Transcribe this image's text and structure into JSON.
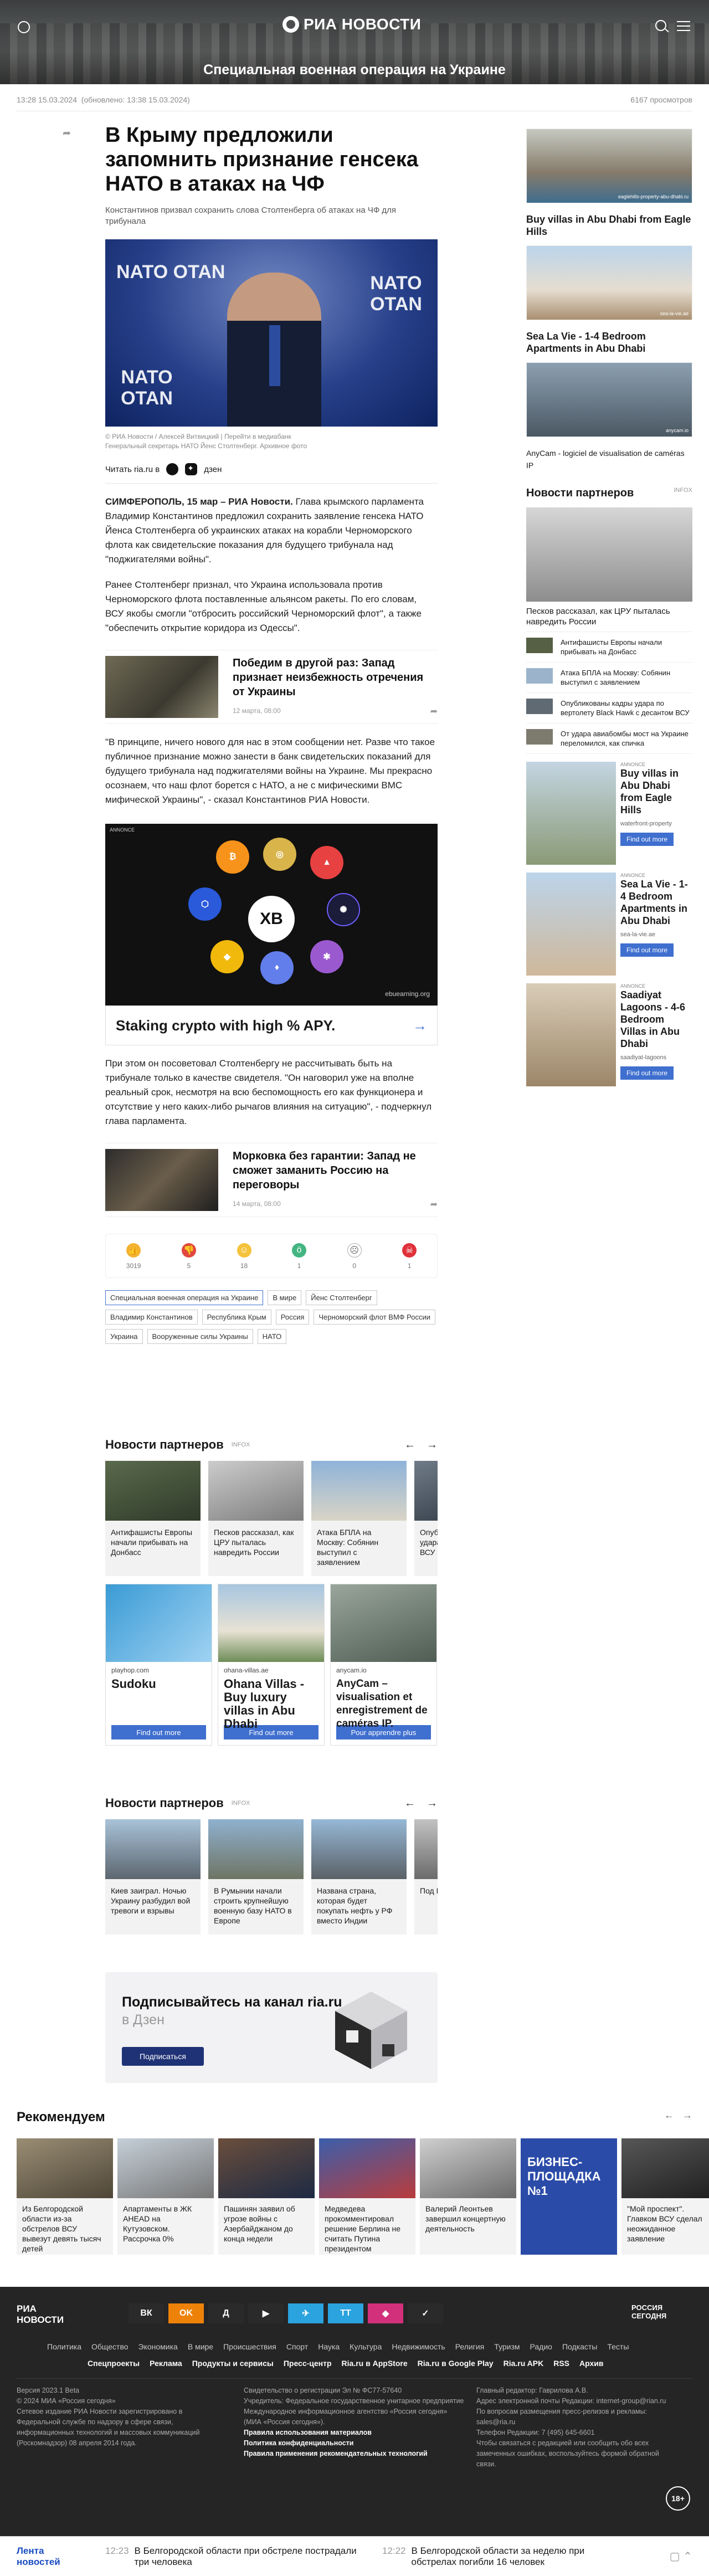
{
  "header": {
    "logo": "РИА НОВОСТИ",
    "section": "Специальная военная операция на Украине"
  },
  "meta": {
    "published": "13:28 15.03.2024",
    "updated": "(обновлено: 13:38 15.03.2024)",
    "views": "6167 просмотров"
  },
  "article": {
    "title": "В Крыму предложили запомнить признание генсека НАТО в атаках на ЧФ",
    "subtitle": "Константинов призвал сохранить слова Столтенберга об атаках на ЧФ для трибунала",
    "photo_labels": [
      "NATO OTAN",
      "NATO OTAN",
      "NATO OTAN"
    ],
    "caption1": "© РИА Новости / Алексей Витвицкий | Перейти в медиабанк",
    "caption2": "Генеральный секретарь НАТО Йенс Столтенберг. Архивное фото",
    "read_label": "Читать ria.ru в",
    "dzen": "дзен",
    "p1_lead": "СИМФЕРОПОЛЬ, 15 мар – РИА Новости.",
    "p1": " Глава крымского парламента Владимир Константинов предложил сохранить заявление генсека НАТО Йенса Столтенберга об украинских атаках на корабли Черноморского флота как свидетельские показания для будущего трибунала над \"поджигателями войны\".",
    "p2": "Ранее Столтенберг признал, что Украина использовала против Черноморского флота поставленные альянсом ракеты. По его словам, ВСУ якобы смогли \"отбросить российский Черноморский флот\", а также \"обеспечить открытие коридора из Одессы\".",
    "card1": {
      "title": "Победим в другой раз: Запад признает неизбежность отречения от Украины",
      "date": "12 марта, 08:00"
    },
    "p3": "\"В принципе, ничего нового для нас в этом сообщении нет. Разве что такое публичное признание можно занести в банк свидетельских показаний для будущего трибунала над поджигателями войны на Украине. Мы прекрасно осознаем, что наш флот борется с НАТО, а не с мифическими ВМС мифической Украины\", - сказал Константинов РИА Новости.",
    "ad": {
      "label": "ANNONCE",
      "title": "Staking crypto with high % APY.",
      "domain": "ebuearning.org",
      "mark": "XB"
    },
    "p4": "При этом он посоветовал Столтенбергу не рассчитывать быть на трибунале только в качестве свидетеля. \"Он наговорил уже на вполне реальный срок, несмотря на всю беспомощность его как функционера и отсутствие у него каких-либо рычагов влияния на ситуацию\", - подчеркнул глава парламента.",
    "card2": {
      "title": "Морковка без гарантии: Запад не сможет заманить Россию на переговоры",
      "date": "14 марта, 08:00"
    },
    "reactions": [
      "3019",
      "5",
      "18",
      "1",
      "0",
      "1"
    ],
    "tags": [
      "Специальная военная операция на Украине",
      "В мире",
      "Йенс Столтенберг",
      "Владимир Константинов",
      "Республика Крым",
      "Россия",
      "Черноморский флот ВМФ России",
      "Украина",
      "Вооруженные силы Украины",
      "НАТО"
    ]
  },
  "partners1": {
    "title": "Новости партнеров",
    "infox": "INFOX",
    "cards": [
      "Антифашисты Европы начали прибывать на Донбасс",
      "Песков рассказал, как ЦРУ пыталась навредить России",
      "Атака БПЛА на Москву: Собянин выступил с заявлением",
      "Опубликованы кадры удара по вертолету ВСУ"
    ]
  },
  "ads_row": [
    {
      "name": "playhop.com",
      "title": "Sudoku",
      "btn": "Find out more"
    },
    {
      "name": "ohana-villas.ae",
      "title": "Ohana Villas - Buy luxury villas in Abu Dhabi",
      "btn": "Find out more"
    },
    {
      "name": "anycam.io",
      "title": "AnyCam – visualisation et enregistrement de caméras IP.",
      "btn": "Pour apprendre plus"
    }
  ],
  "partners2": {
    "title": "Новости партнеров",
    "infox": "INFOX",
    "cards": [
      "Киев заиграл. Ночью Украину разбудил вой тревоги и взрывы",
      "В Румынии начали строить крупнейшую военную базу НАТО в Европе",
      "Названа страна, которая будет покупать нефть у РФ вместо Индии",
      "Под Кр…"
    ]
  },
  "dzen_banner": {
    "line1": "Подписывайтесь на канал ria.ru",
    "line2": "в Дзен",
    "btn": "Подписаться"
  },
  "sidebar": {
    "ads": [
      {
        "title": "Buy villas in Abu Dhabi from Eagle Hills",
        "domain": "eaglehills-property-abu-dhabi.ru"
      },
      {
        "title": "Sea La Vie - 1-4 Bedroom Apartments in Abu Dhabi",
        "domain": "sea-la-vie.ae"
      },
      {
        "title": "AnyCam - logiciel de visualisation de caméras IP",
        "domain": "anycam.io"
      }
    ],
    "partners_title": "Новости партнеров",
    "infox": "INFOX",
    "top_story": "Песков рассказал, как ЦРУ пыталась навредить России",
    "news": [
      "Антифашисты Европы начали прибывать на Донбасс",
      "Атака БПЛА на Москву: Собянин выступил с заявлением",
      "Опубликованы кадры удара по вертолету Black Hawk с десантом ВСУ",
      "От удара авиабомбы мост на Украине переломился, как спичка"
    ],
    "promo": [
      {
        "title": "Buy villas in Abu Dhabi from Eagle Hills",
        "link": "waterfront-property",
        "btn": "Find out more",
        "tag": "ANNONCE"
      },
      {
        "title": "Sea La Vie - 1-4 Bedroom Apartments in Abu Dhabi",
        "link": "sea-la-vie.ae",
        "btn": "Find out more",
        "tag": "ANNONCE"
      },
      {
        "title": "Saadiyat Lagoons - 4-6 Bedroom Villas in Abu Dhabi",
        "link": "saadiyat-lagoons",
        "btn": "Find out more",
        "tag": "ANNONCE"
      }
    ]
  },
  "recommend": {
    "title": "Рекомендуем",
    "cards": [
      "Из Белгородской области из-за обстрелов ВСУ вывезут девять тысяч детей",
      "Апартаменты в ЖК AHEAD на Кутузовском. Рассрочка 0%",
      "Пашинян заявил об угрозе войны с Азербайджаном до конца недели",
      "Медведева прокомментировал решение Берлина не считать Путина президентом",
      "Валерий Леонтьев завершил концертную деятельность",
      "БИЗНЕС-ПЛОЩАДКА №1",
      "\"Мой проспект\". Главком ВСУ сделал неожиданное заявление"
    ],
    "ad_note": "landing.akademkvartal.ru"
  },
  "footer": {
    "logo": "РИА НОВОСТИ",
    "social": [
      "ВК",
      "OK",
      "Д",
      "▶",
      "✈",
      "TT",
      "◆",
      "✓"
    ],
    "partner_logo": "РОССИЯ СЕГОДНЯ",
    "nav": [
      "Политика",
      "Общество",
      "Экономика",
      "В мире",
      "Происшествия",
      "Спорт",
      "Наука",
      "Культура",
      "Недвижимость",
      "Религия",
      "Туризм",
      "Радио",
      "Подкасты",
      "Тесты"
    ],
    "nav2": [
      "Спецпроекты",
      "Реклама",
      "Продукты и сервисы",
      "Пресс-центр",
      "Ria.ru в AppStore",
      "Ria.ru в Google Play",
      "Ria.ru APK",
      "RSS",
      "Архив"
    ],
    "col1": [
      "Версия 2023.1 Beta",
      "© 2024 МИА «Россия сегодня»",
      "Сетевое издание РИА Новости зарегистрировано в Федеральной службе по надзору в сфере связи, информационных технологий и массовых коммуникаций (Роскомнадзор) 08 апреля 2014 года."
    ],
    "col2": [
      "Свидетельство о регистрации Эл № ФС77-57640",
      "Учредитель: Федеральное государственное унитарное предприятие Международное информационное агентство «Россия сегодня» (МИА «Россия сегодня»).",
      "Правила использования материалов",
      "Политика конфиденциальности",
      "Правила применения рекомендательных технологий"
    ],
    "col3": [
      "Главный редактор: Гаврилова А.В.",
      "Адрес электронной почты Редакции: internet-group@rian.ru",
      "По вопросам размещения пресс-релизов и рекламы: sales@ria.ru",
      "Телефон Редакции: 7 (495) 645-6601",
      "Чтобы связаться с редакцией или сообщить обо всех замеченных ошибках, воспользуйтесь формой обратной связи."
    ],
    "age": "18+"
  },
  "bottombar": {
    "label": "Лента новостей",
    "items": [
      {
        "time": "12:23",
        "text": "В Белгородской области при обстреле пострадали три человека"
      },
      {
        "time": "12:22",
        "text": "В Белгородской области за неделю при обстрелах погибли 16 человек"
      }
    ]
  }
}
